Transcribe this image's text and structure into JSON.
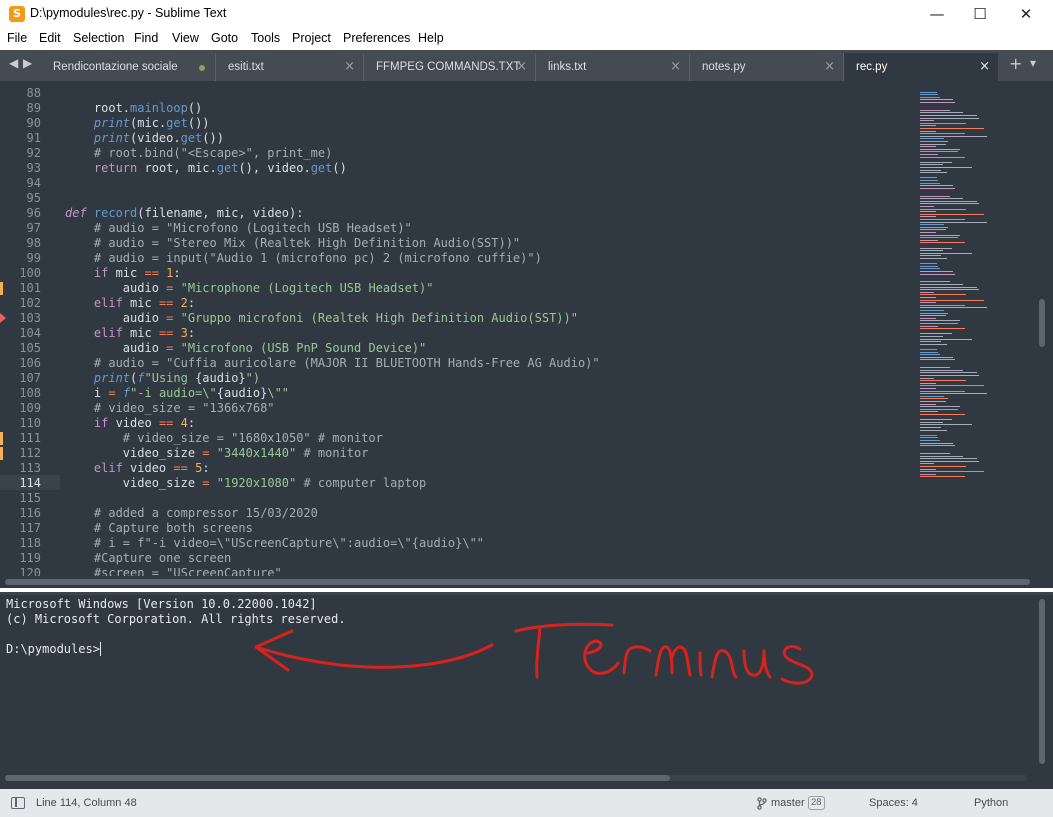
{
  "window": {
    "app_icon_letter": "S",
    "title": "D:\\pymodules\\rec.py - Sublime Text",
    "minimize": "—",
    "maximize": "☐",
    "close": "✕"
  },
  "menu": [
    "File",
    "Edit",
    "Selection",
    "Find",
    "View",
    "Goto",
    "Tools",
    "Project",
    "Preferences",
    "Help"
  ],
  "tabbar": {
    "prev": "◀",
    "next": "▶",
    "new_tab": "+",
    "overflow": "▾",
    "tabs": [
      {
        "label": "Rendicontazione sociale",
        "dirty": true
      },
      {
        "label": "esiti.txt"
      },
      {
        "label": "FFMPEG COMMANDS.TXT"
      },
      {
        "label": "links.txt"
      },
      {
        "label": "notes.py"
      },
      {
        "label": "rec.py",
        "active": true
      }
    ],
    "close_glyph": "×"
  },
  "editor": {
    "lines": [
      {
        "n": "88",
        "segs": [
          {
            "t": ""
          }
        ]
      },
      {
        "n": "89",
        "segs": [
          {
            "t": "    root."
          },
          {
            "t": "mainloop",
            "c": "fn"
          },
          {
            "t": "()"
          }
        ]
      },
      {
        "n": "90",
        "segs": [
          {
            "t": "    "
          },
          {
            "t": "print",
            "c": "bi"
          },
          {
            "t": "(mic."
          },
          {
            "t": "get",
            "c": "fn"
          },
          {
            "t": "())"
          }
        ]
      },
      {
        "n": "91",
        "segs": [
          {
            "t": "    "
          },
          {
            "t": "print",
            "c": "bi"
          },
          {
            "t": "(video."
          },
          {
            "t": "get",
            "c": "fn"
          },
          {
            "t": "())"
          }
        ]
      },
      {
        "n": "92",
        "segs": [
          {
            "t": "    # root.bind(\"<Escape>\", print_me)",
            "c": "cm"
          }
        ]
      },
      {
        "n": "93",
        "segs": [
          {
            "t": "    "
          },
          {
            "t": "return",
            "c": "kw"
          },
          {
            "t": " root, mic."
          },
          {
            "t": "get",
            "c": "fn"
          },
          {
            "t": "(), video."
          },
          {
            "t": "get",
            "c": "fn"
          },
          {
            "t": "()"
          }
        ]
      },
      {
        "n": "94",
        "segs": [
          {
            "t": ""
          }
        ]
      },
      {
        "n": "95",
        "segs": [
          {
            "t": ""
          }
        ]
      },
      {
        "n": "96",
        "segs": [
          {
            "t": "def",
            "c": "def"
          },
          {
            "t": " "
          },
          {
            "t": "record",
            "c": "fn"
          },
          {
            "t": "(filename, mic, video):"
          }
        ]
      },
      {
        "n": "97",
        "segs": [
          {
            "t": "    # audio = \"Microfono (Logitech USB Headset)\"",
            "c": "cm"
          }
        ]
      },
      {
        "n": "98",
        "segs": [
          {
            "t": "    # audio = \"Stereo Mix (Realtek High Definition Audio(SST))\"",
            "c": "cm"
          }
        ]
      },
      {
        "n": "99",
        "segs": [
          {
            "t": "    # audio = input(\"Audio 1 (microfono pc) 2 (microfono cuffie)\")",
            "c": "cm"
          }
        ]
      },
      {
        "n": "100",
        "segs": [
          {
            "t": "    "
          },
          {
            "t": "if",
            "c": "kw"
          },
          {
            "t": " mic "
          },
          {
            "t": "==",
            "c": "op"
          },
          {
            "t": " "
          },
          {
            "t": "1",
            "c": "num"
          },
          {
            "t": ":"
          }
        ]
      },
      {
        "n": "101",
        "segs": [
          {
            "t": "        audio "
          },
          {
            "t": "=",
            "c": "op"
          },
          {
            "t": " "
          },
          {
            "t": "\"Microphone (Logitech USB Headset)\"",
            "c": "str"
          }
        ]
      },
      {
        "n": "102",
        "segs": [
          {
            "t": "    "
          },
          {
            "t": "elif",
            "c": "kw"
          },
          {
            "t": " mic "
          },
          {
            "t": "==",
            "c": "op"
          },
          {
            "t": " "
          },
          {
            "t": "2",
            "c": "num"
          },
          {
            "t": ":"
          }
        ]
      },
      {
        "n": "103",
        "segs": [
          {
            "t": "        audio "
          },
          {
            "t": "=",
            "c": "op"
          },
          {
            "t": " "
          },
          {
            "t": "\"Gruppo microfoni (Realtek High Definition Audio(SST))\"",
            "c": "str"
          }
        ]
      },
      {
        "n": "104",
        "segs": [
          {
            "t": "    "
          },
          {
            "t": "elif",
            "c": "kw"
          },
          {
            "t": " mic "
          },
          {
            "t": "==",
            "c": "op"
          },
          {
            "t": " "
          },
          {
            "t": "3",
            "c": "num"
          },
          {
            "t": ":"
          }
        ]
      },
      {
        "n": "105",
        "segs": [
          {
            "t": "        audio "
          },
          {
            "t": "=",
            "c": "op"
          },
          {
            "t": " "
          },
          {
            "t": "\"Microfono (USB PnP Sound Device)\"",
            "c": "str"
          }
        ]
      },
      {
        "n": "106",
        "segs": [
          {
            "t": "    # audio = \"Cuffia auricolare (MAJOR II BLUETOOTH Hands-Free AG Audio)\"",
            "c": "cm"
          }
        ]
      },
      {
        "n": "107",
        "segs": [
          {
            "t": "    "
          },
          {
            "t": "print",
            "c": "bi"
          },
          {
            "t": "("
          },
          {
            "t": "f",
            "c": "bi"
          },
          {
            "t": "\"Using ",
            "c": "str"
          },
          {
            "t": "{audio}"
          },
          {
            "t": "\")",
            "c": "str"
          }
        ]
      },
      {
        "n": "108",
        "segs": [
          {
            "t": "    i "
          },
          {
            "t": "=",
            "c": "op"
          },
          {
            "t": " "
          },
          {
            "t": "f",
            "c": "bi"
          },
          {
            "t": "\"-i audio=\\\"",
            "c": "str"
          },
          {
            "t": "{audio}"
          },
          {
            "t": "\\\"\"",
            "c": "str"
          }
        ]
      },
      {
        "n": "109",
        "segs": [
          {
            "t": "    # video_size = \"1366x768\"",
            "c": "cm"
          }
        ]
      },
      {
        "n": "110",
        "segs": [
          {
            "t": "    "
          },
          {
            "t": "if",
            "c": "kw"
          },
          {
            "t": " video "
          },
          {
            "t": "==",
            "c": "op"
          },
          {
            "t": " "
          },
          {
            "t": "4",
            "c": "num"
          },
          {
            "t": ":"
          }
        ]
      },
      {
        "n": "111",
        "segs": [
          {
            "t": "        # video_size = \"1680x1050\" # monitor",
            "c": "cm"
          }
        ]
      },
      {
        "n": "112",
        "segs": [
          {
            "t": "        video_size "
          },
          {
            "t": "=",
            "c": "op"
          },
          {
            "t": " "
          },
          {
            "t": "\"3440x1440\"",
            "c": "str"
          },
          {
            "t": " # monitor",
            "c": "cm"
          }
        ]
      },
      {
        "n": "113",
        "segs": [
          {
            "t": "    "
          },
          {
            "t": "elif",
            "c": "kw"
          },
          {
            "t": " video "
          },
          {
            "t": "==",
            "c": "op"
          },
          {
            "t": " "
          },
          {
            "t": "5",
            "c": "num"
          },
          {
            "t": ":"
          }
        ]
      },
      {
        "n": "114",
        "segs": [
          {
            "t": "        video_size "
          },
          {
            "t": "=",
            "c": "op"
          },
          {
            "t": " "
          },
          {
            "t": "\"1920x1080\"",
            "c": "str"
          },
          {
            "t": " # computer laptop",
            "c": "cm"
          }
        ],
        "current": true
      },
      {
        "n": "115",
        "segs": [
          {
            "t": ""
          }
        ]
      },
      {
        "n": "116",
        "segs": [
          {
            "t": "    # added a compressor 15/03/2020",
            "c": "cm"
          }
        ]
      },
      {
        "n": "117",
        "segs": [
          {
            "t": "    # Capture both screens",
            "c": "cm"
          }
        ]
      },
      {
        "n": "118",
        "segs": [
          {
            "t": "    # i = f\"-i video=\\\"UScreenCapture\\\":audio=\\\"{audio}\\\"\"",
            "c": "cm"
          }
        ]
      },
      {
        "n": "119",
        "segs": [
          {
            "t": "    #Capture one screen",
            "c": "cm"
          }
        ]
      },
      {
        "n": "120",
        "segs": [
          {
            "t": "    #screen = \"UScreenCapture\"",
            "c": "cm"
          }
        ]
      }
    ],
    "modified_lines": [
      "101",
      "111",
      "112"
    ],
    "removed_marker_line": "103"
  },
  "syntax_colors": {
    "fn": "#6699cc",
    "bi": "#6699cc",
    "kw": "#c594c5",
    "def": "#c594c5",
    "op": "#f97b58",
    "num": "#f9ae58",
    "str": "#99c794",
    "cm": "#a6acb9",
    "text": "#d8dee9"
  },
  "terminal": {
    "lines": [
      "Microsoft Windows [Version 10.0.22000.1042]",
      "(c) Microsoft Corporation. All rights reserved.",
      "",
      "D:\\pymodules>"
    ],
    "annotation_color": "#d8231c"
  },
  "statusbar": {
    "position": "Line 114, Column 48",
    "branch_icon": "branch-icon",
    "branch": "master",
    "branch_count": "28",
    "indentation": "Spaces: 4",
    "syntax": "Python"
  }
}
